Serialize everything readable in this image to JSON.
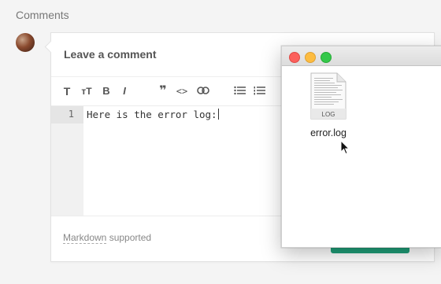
{
  "section": {
    "heading": "Comments"
  },
  "comment_box": {
    "title": "Leave a comment",
    "toolbar": {
      "header": "T",
      "text_size": "тT",
      "bold": "B",
      "italic": "I",
      "quote": "❞",
      "code": "<>",
      "link": "⊂⊃",
      "bulleted_list": "☰",
      "numbered_list": "☰"
    },
    "editor": {
      "line_number": "1",
      "text": "Here is the error log:"
    },
    "footer": {
      "markdown_link": "Markdown",
      "supported": "supported"
    }
  },
  "finder": {
    "file": {
      "name": "error.log",
      "type_label": "LOG"
    }
  },
  "colors": {
    "accent_green": "#1f9e78",
    "traffic_close": "#fc605c",
    "traffic_minimize": "#fdbc40",
    "traffic_zoom": "#34c84a"
  }
}
